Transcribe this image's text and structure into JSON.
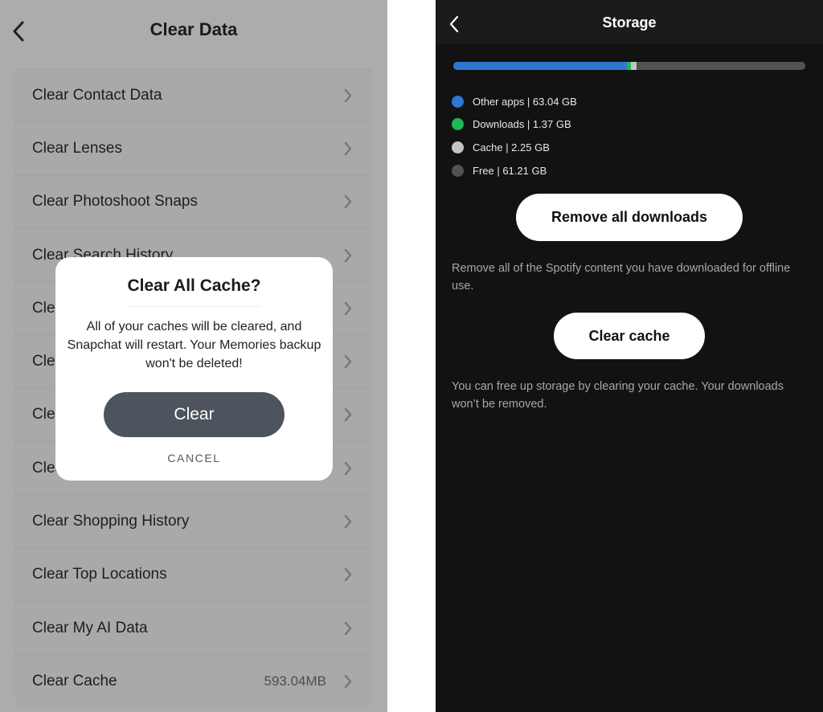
{
  "snapchat": {
    "header": {
      "title": "Clear Data",
      "back_icon": "chevron-left-icon"
    },
    "items": [
      {
        "label": "Clear Contact Data",
        "value": ""
      },
      {
        "label": "Clear Lenses",
        "value": ""
      },
      {
        "label": "Clear Photoshoot Snaps",
        "value": ""
      },
      {
        "label": "Clear Search History",
        "value": ""
      },
      {
        "label": "Clear",
        "value": ""
      },
      {
        "label": "Clear",
        "value": ""
      },
      {
        "label": "Clear",
        "value": ""
      },
      {
        "label": "Clear",
        "value": ""
      },
      {
        "label": "Clear Shopping History",
        "value": ""
      },
      {
        "label": "Clear Top Locations",
        "value": ""
      },
      {
        "label": "Clear My AI Data",
        "value": ""
      },
      {
        "label": "Clear Cache",
        "value": "593.04MB"
      }
    ],
    "dialog": {
      "title": "Clear All Cache?",
      "body": "All of your caches will be cleared, and Snapchat will restart. Your Memories backup won't be deleted!",
      "confirm_label": "Clear",
      "cancel_label": "CANCEL"
    },
    "colors": {
      "overlay_bg": "#acacac",
      "confirm_button": "#4d545d"
    }
  },
  "spotify": {
    "header": {
      "title": "Storage",
      "back_icon": "chevron-left-icon"
    },
    "storage": {
      "unit": "GB",
      "segments": [
        {
          "name": "Other apps",
          "value": 63.04,
          "label": "Other apps | 63.04 GB",
          "color": "#2e77d0"
        },
        {
          "name": "Downloads",
          "value": 1.37,
          "label": "Downloads | 1.37 GB",
          "color": "#1db954"
        },
        {
          "name": "Cache",
          "value": 2.25,
          "label": "Cache | 2.25 GB",
          "color": "#c4c4c4"
        },
        {
          "name": "Free",
          "value": 61.21,
          "label": "Free | 61.21 GB",
          "color": "#535353"
        }
      ]
    },
    "remove_downloads": {
      "label": "Remove all downloads",
      "description": "Remove all of the Spotify content you have downloaded for offline use."
    },
    "clear_cache": {
      "label": "Clear cache",
      "description": "You can free up storage by clearing your cache. Your downloads won’t be removed."
    }
  }
}
